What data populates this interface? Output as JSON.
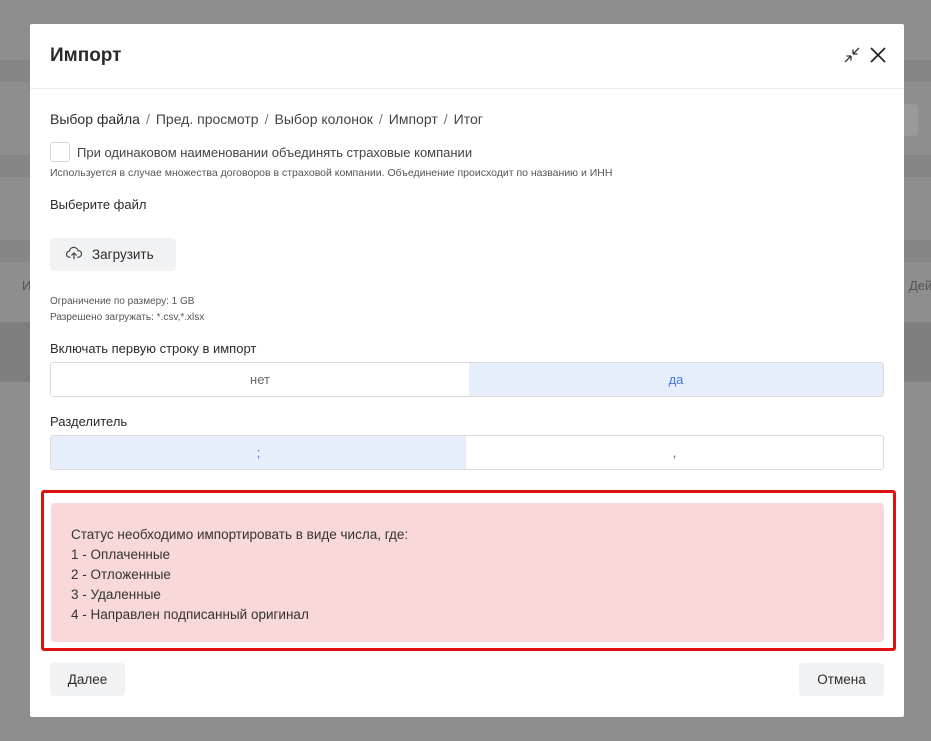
{
  "background": {
    "left_text": "И",
    "right_text": "Дей"
  },
  "modal": {
    "title": "Импорт",
    "collapse_icon": "collapse-arrows-icon",
    "close_icon": "close-icon"
  },
  "breadcrumbs": [
    {
      "label": "Выбор файла",
      "active": true
    },
    {
      "label": "Пред. просмотр",
      "active": false
    },
    {
      "label": "Выбор колонок",
      "active": false
    },
    {
      "label": "Импорт",
      "active": false
    },
    {
      "label": "Итог",
      "active": false
    }
  ],
  "breadcrumb_separator": "/",
  "merge_option": {
    "label": "При одинаковом наименовании объединять страховые компании",
    "checked": false,
    "hint": "Используется в случае множества договоров в страховой компании. Объединение происходит по названию и ИНН"
  },
  "file": {
    "label": "Выберите файл",
    "upload_label": "Загрузить",
    "upload_icon": "cloud-upload-icon",
    "size_limit": "Ограничение по размеру: 1 GB",
    "allowed_types": "Разрешено загружать: *.csv,*.xlsx"
  },
  "first_row": {
    "label": "Включать первую строку в импорт",
    "options": [
      "нет",
      "да"
    ],
    "selected": "да"
  },
  "separator": {
    "label": "Разделитель",
    "options": [
      ";",
      ","
    ],
    "selected": ";"
  },
  "alert": {
    "lines": [
      "Статус необходимо импортировать в виде числа, где:",
      "1 - Оплаченные",
      "2 - Отложенные",
      "3 - Удаленные",
      "4 - Направлен подписанный оригинал"
    ],
    "background_color": "#f8d8d9",
    "outline_color": "#e01010"
  },
  "footer": {
    "next_label": "Далее",
    "cancel_label": "Отмена"
  },
  "colors": {
    "accent": "#3d7bd6",
    "accent_bg": "#e6eefb",
    "overlay": "#8e8e8e"
  }
}
